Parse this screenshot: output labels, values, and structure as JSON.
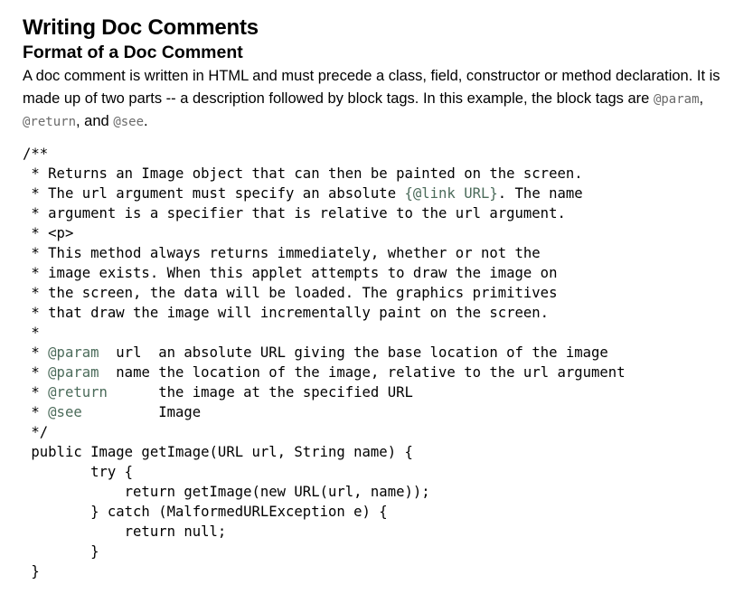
{
  "title": "Writing Doc Comments",
  "subtitle": "Format of a Doc Comment",
  "intro": {
    "text_before": "A doc comment is written in HTML and must precede a class, field, constructor or method declaration. It is made up of two parts -- a description followed by block tags. In this example, the block tags are ",
    "tag_param": "@param",
    "sep1": ", ",
    "tag_return": "@return",
    "sep2": ", and ",
    "tag_see": "@see",
    "end": "."
  },
  "code": {
    "l01": "/**",
    "l02": " * Returns an Image object that can then be painted on the screen.",
    "l03a": " * The url argument must specify an absolute ",
    "l03_link": "{@link URL}",
    "l03b": ". The name",
    "l04": " * argument is a specifier that is relative to the url argument.",
    "l05": " * <p>",
    "l06": " * This method always returns immediately, whether or not the",
    "l07": " * image exists. When this applet attempts to draw the image on",
    "l08": " * the screen, the data will be loaded. The graphics primitives",
    "l09": " * that draw the image will incrementally paint on the screen.",
    "l10": " *",
    "l11_prefix": " * ",
    "l11_tag": "@param",
    "l11_rest": "  url  an absolute URL giving the base location of the image",
    "l12_prefix": " * ",
    "l12_tag": "@param",
    "l12_rest": "  name the location of the image, relative to the url argument",
    "l13_prefix": " * ",
    "l13_tag": "@return",
    "l13_rest": "      the image at the specified URL",
    "l14_prefix": " * ",
    "l14_tag": "@see",
    "l14_rest": "         Image",
    "l15": " */",
    "l16": " public Image getImage(URL url, String name) {",
    "l17": "        try {",
    "l18": "            return getImage(new URL(url, name));",
    "l19": "        } catch (MalformedURLException e) {",
    "l20": "            return null;",
    "l21": "        }",
    "l22": " }"
  }
}
